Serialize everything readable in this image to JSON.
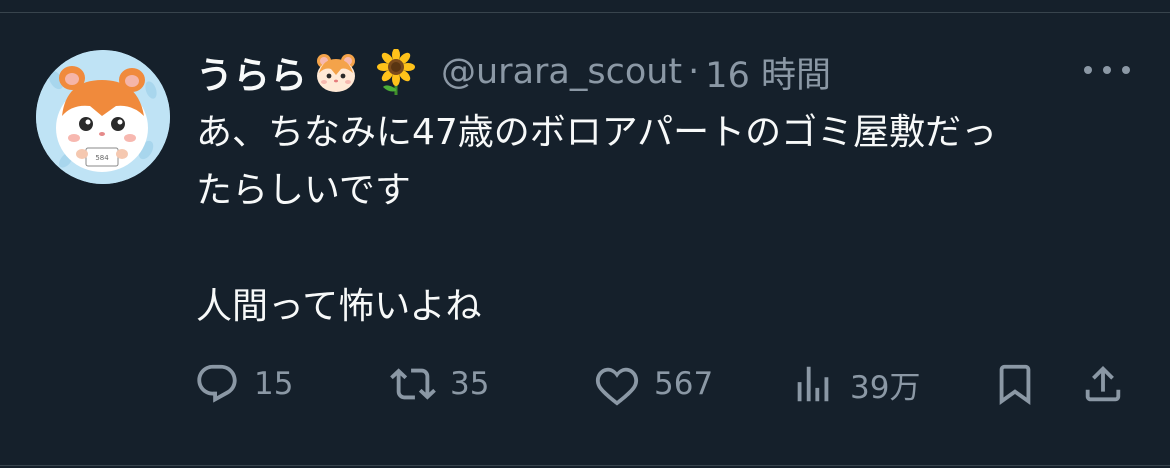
{
  "tweet": {
    "display_name": "うらら",
    "name_emojis": [
      "hamster-emoji",
      "sunflower-emoji"
    ],
    "handle": "@urara_scout",
    "separator": "·",
    "time": "16 時間",
    "text_lines": [
      "あ、ちなみに47歳のボロアパートのゴミ屋敷だっ",
      "たらしいです",
      "",
      "人間って怖いよね"
    ]
  },
  "actions": {
    "reply_count": "15",
    "retweet_count": "35",
    "like_count": "567",
    "views_count": "39万"
  },
  "colors": {
    "background": "#15202b",
    "primary_text": "#f7f9f9",
    "secondary_text": "#8b98a5",
    "divider": "#38444d"
  }
}
